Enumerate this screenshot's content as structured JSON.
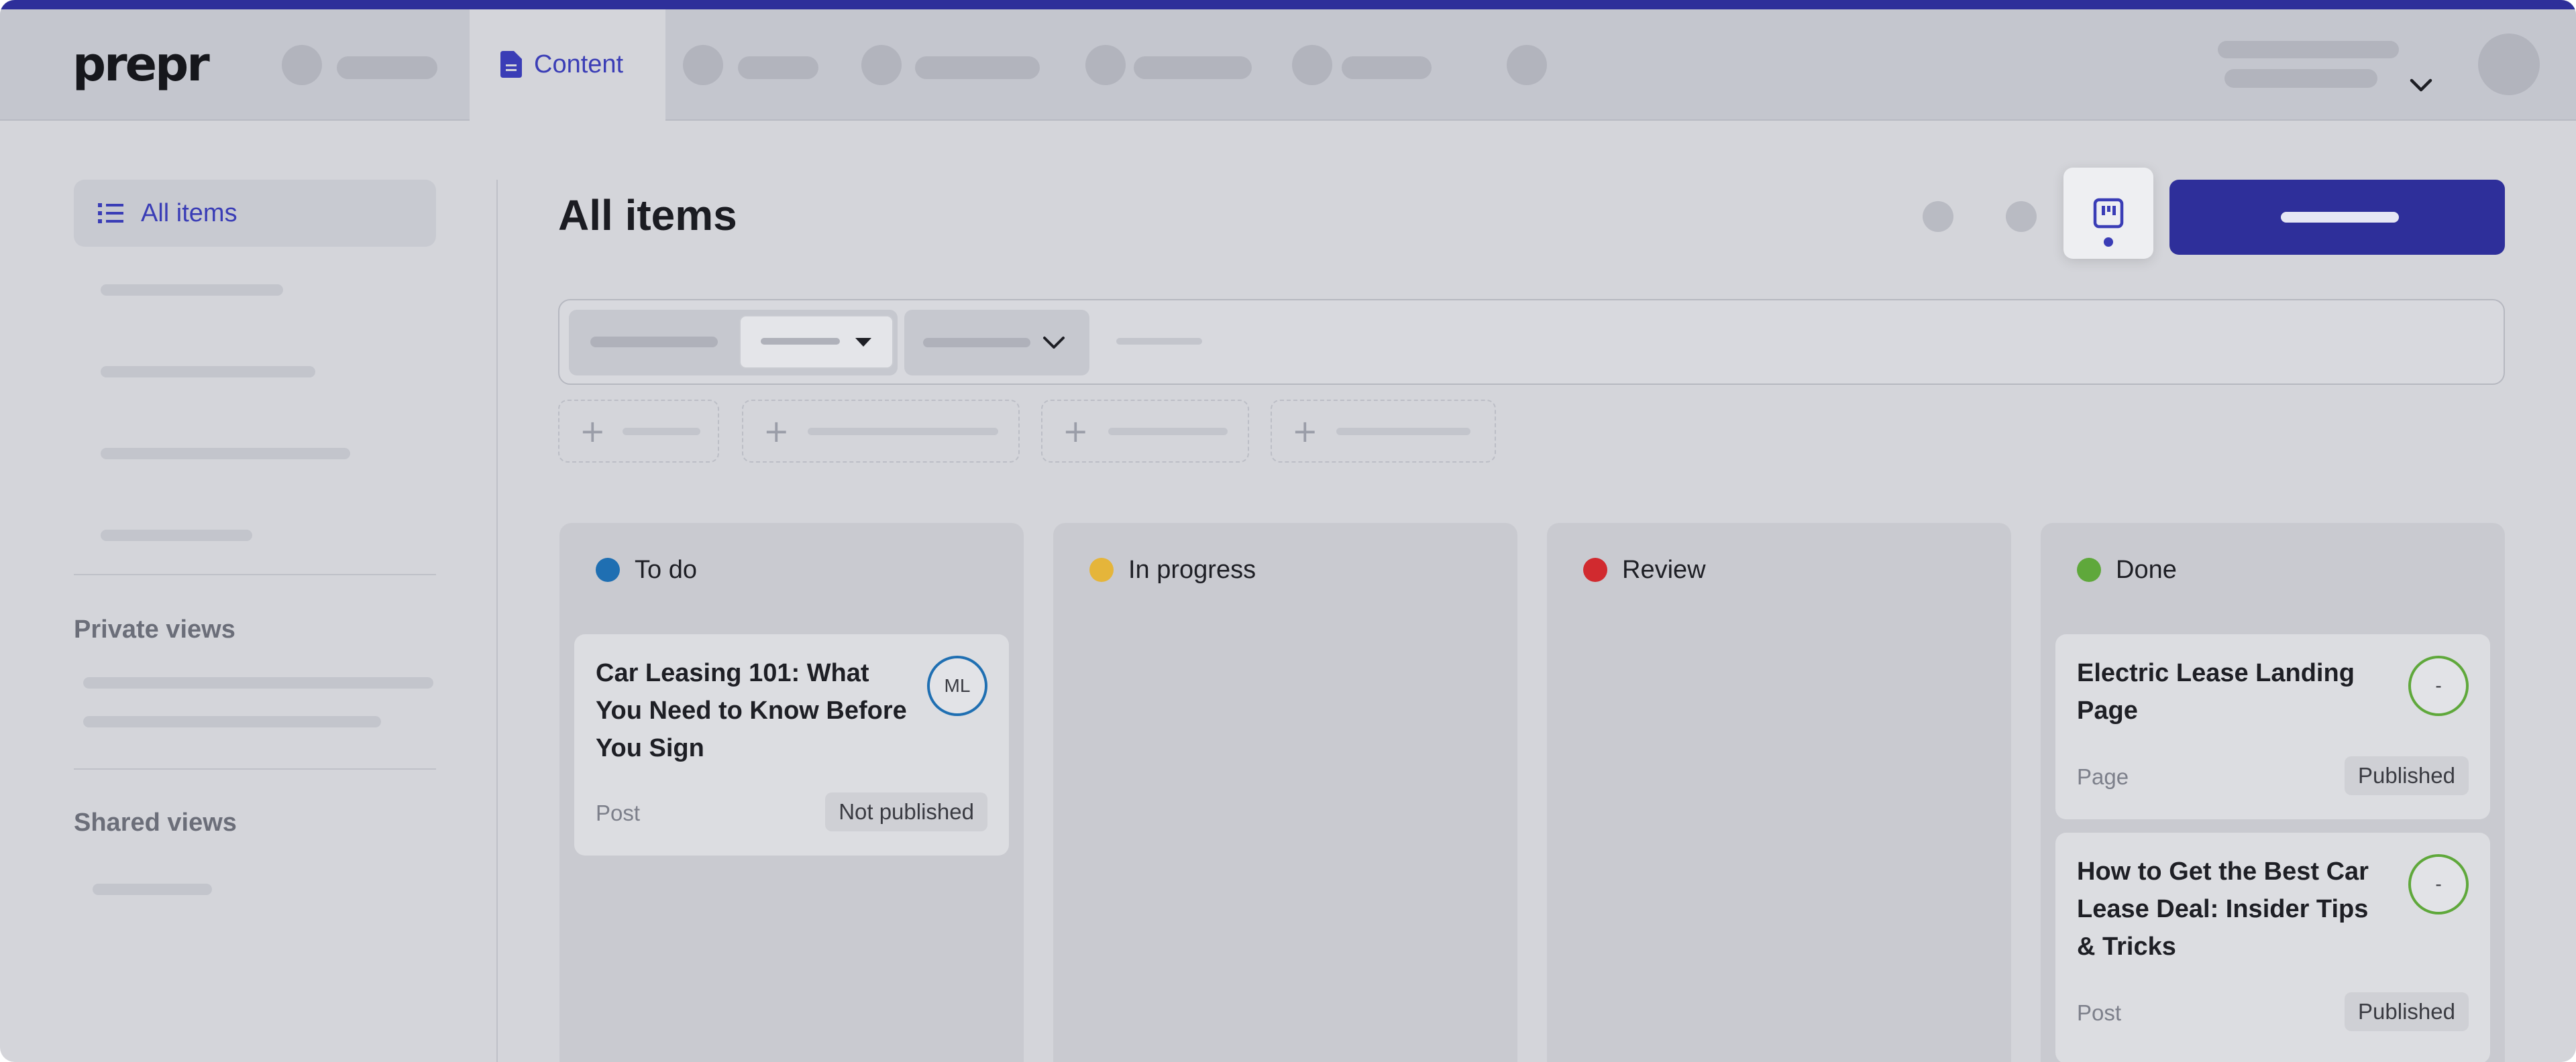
{
  "app": {
    "logo_text": "prepr"
  },
  "header": {
    "active_tab": {
      "label": "Content",
      "icon": "document-icon"
    },
    "account_menu_icon": "chevron-down-icon"
  },
  "sidebar": {
    "active_item": {
      "label": "All items",
      "icon": "list-icon"
    },
    "private_views_heading": "Private views",
    "shared_views_heading": "Shared views"
  },
  "main": {
    "title": "All items",
    "view_toggle_icon": "kanban-icon"
  },
  "colors": {
    "accent": "#2e2f9a",
    "todo": "#1f6fb2",
    "in_progress": "#e5b53a",
    "review": "#d12a2f",
    "done": "#5fa83b"
  },
  "board": {
    "columns": [
      {
        "title": "To do",
        "cards": [
          {
            "title": "Car Leasing 101: What You Need to Know Before You Sign",
            "type": "Post",
            "status": "Not published",
            "avatar": "ML"
          }
        ]
      },
      {
        "title": "In progress",
        "cards": []
      },
      {
        "title": "Review",
        "cards": []
      },
      {
        "title": "Done",
        "cards": [
          {
            "title": "Electric Lease Landing Page",
            "type": "Page",
            "status": "Published",
            "avatar": "-"
          },
          {
            "title": "How to Get the Best Car Lease Deal: Insider Tips & Tricks",
            "type": "Post",
            "status": "Published",
            "avatar": "-"
          }
        ]
      }
    ]
  }
}
